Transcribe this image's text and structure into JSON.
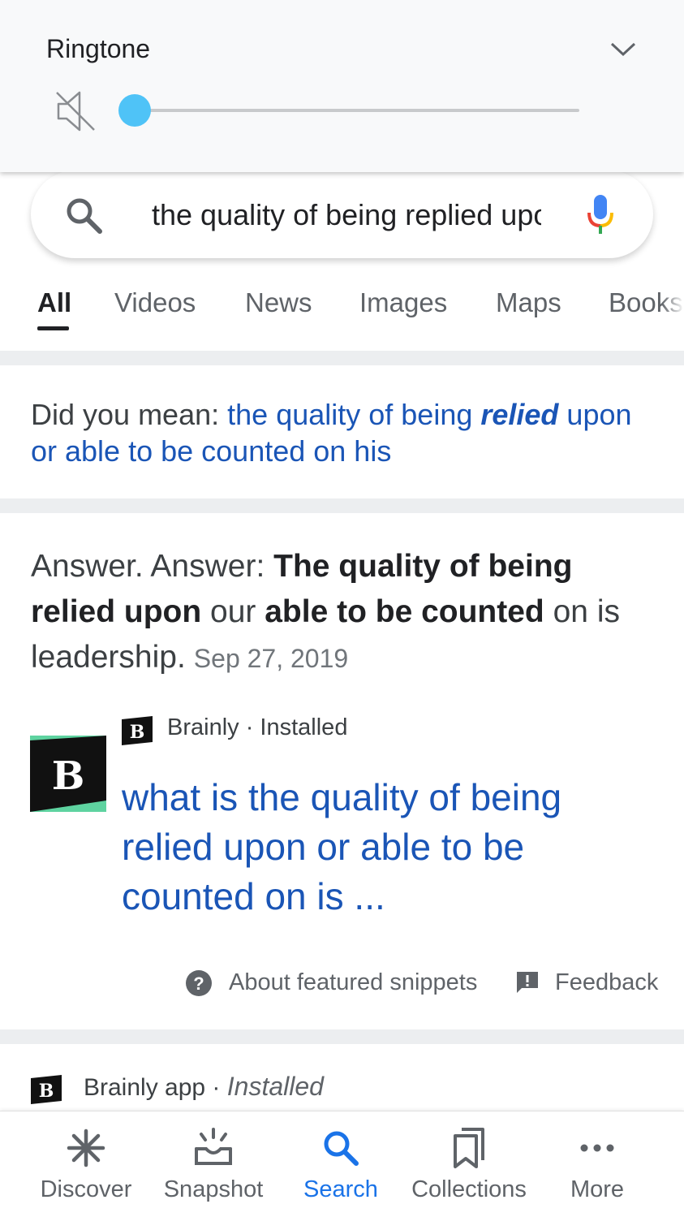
{
  "volume_panel": {
    "title": "Ringtone",
    "level_percent": 0,
    "accent_color": "#4fc3f7"
  },
  "search": {
    "query": "the quality of being replied upon or able to be counted on his"
  },
  "tabs": [
    {
      "label": "All",
      "active": true
    },
    {
      "label": "Videos",
      "active": false
    },
    {
      "label": "News",
      "active": false
    },
    {
      "label": "Images",
      "active": false
    },
    {
      "label": "Maps",
      "active": false
    },
    {
      "label": "Books",
      "active": false
    }
  ],
  "did_you_mean": {
    "prefix": "Did you mean:",
    "part1": "the quality of being ",
    "emphasis": "relied",
    "part2": " upon or able to be counted on his"
  },
  "answer": {
    "t1": "Answer. Answer: ",
    "b1": "The quality of being relied upon",
    "t2": " our ",
    "b2": "able to be counted",
    "t3": " on is leadership.",
    "date": "Sep 27, 2019"
  },
  "result": {
    "source_name": "Brainly",
    "source_status": " · Installed",
    "title": "what is the quality of being relied upon or able to be counted on is ...",
    "logo_letter": "B"
  },
  "snippet_footer": {
    "about": "About featured snippets",
    "feedback": "Feedback"
  },
  "app_result": {
    "name": "Brainly app",
    "separator": " · ",
    "status": "Installed"
  },
  "bottom_nav": [
    {
      "label": "Discover",
      "icon": "asterisk-icon",
      "active": false
    },
    {
      "label": "Snapshot",
      "icon": "snapshot-icon",
      "active": false
    },
    {
      "label": "Search",
      "icon": "search-icon",
      "active": true
    },
    {
      "label": "Collections",
      "icon": "collections-icon",
      "active": false
    },
    {
      "label": "More",
      "icon": "more-dots-icon",
      "active": false
    }
  ],
  "colors": {
    "link": "#1a55b6",
    "active_nav": "#1a73e8",
    "brainly_green": "#5ed3a0"
  }
}
